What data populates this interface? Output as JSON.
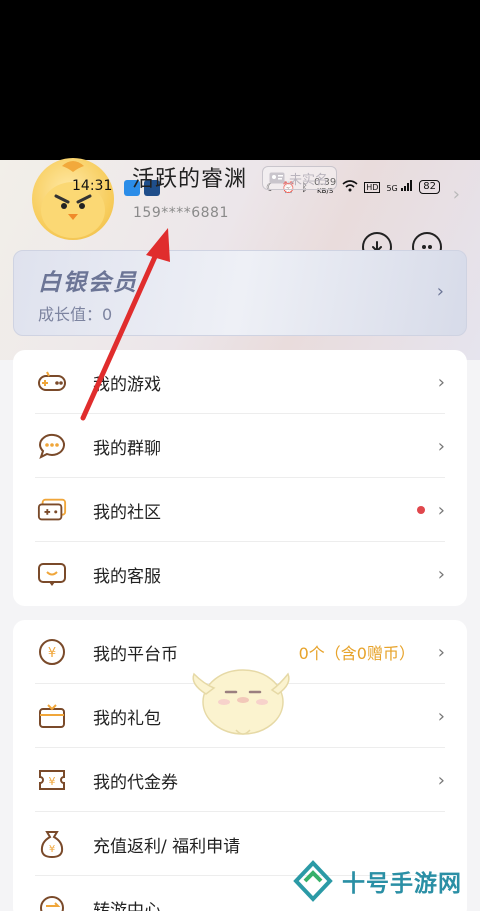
{
  "status_bar": {
    "time": "14:31",
    "net_speed": "0.39",
    "net_unit": "KB/S",
    "signal": "5G",
    "battery": "82"
  },
  "profile": {
    "nickname": "活跃的睿渊",
    "realname_badge": "未实名",
    "phone": "159****6881"
  },
  "vip": {
    "title": "白银会员",
    "growth": "成长值：0"
  },
  "menu_group_1": [
    {
      "label": "我的游戏",
      "icon": "gamepad-icon"
    },
    {
      "label": "我的群聊",
      "icon": "chat-bubble-icon"
    },
    {
      "label": "我的社区",
      "icon": "community-icon"
    },
    {
      "label": "我的客服",
      "icon": "customer-service-icon"
    }
  ],
  "menu_group_2": [
    {
      "label": "我的平台币",
      "icon": "coin-icon",
      "value": "0个（含0赠币）"
    },
    {
      "label": "我的礼包",
      "icon": "gift-icon"
    },
    {
      "label": "我的代金券",
      "icon": "voucher-icon"
    },
    {
      "label": "充值返利/ 福利申请",
      "icon": "money-bag-icon"
    },
    {
      "label": "转游中心",
      "icon": "transfer-icon"
    }
  ],
  "watermark": {
    "text": "十号手游网"
  },
  "colors": {
    "accent": "#e7a32b",
    "annotation_arrow": "#e02d2d",
    "vip_text": "#6c7596"
  }
}
